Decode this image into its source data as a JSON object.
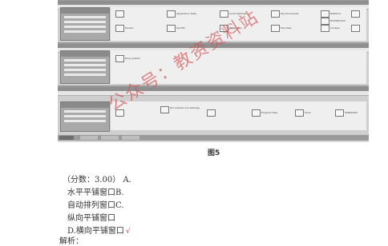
{
  "figure": {
    "caption": "图5",
    "windows": [
      {
        "folders": [
          "",
          "Application Data",
          "Local Settings",
          "My Documents",
          "NetHood",
          "NTUSER.DAT",
          "Recent",
          "SendTo",
          "Templates",
          "Favorites",
          "Cookies",
          "",
          "",
          ""
        ]
      },
      {
        "folders": [
          "Dise_system"
        ]
      },
      {
        "folders": [
          "Documents and Settings",
          "",
          "Program Files",
          "Tools",
          "WINDOWS"
        ]
      }
    ]
  },
  "question": {
    "score_line": "（分数：3.00） A.",
    "options": [
      {
        "text": "水平平铺窗口B."
      },
      {
        "text": "自动排列窗口C."
      },
      {
        "text": "纵向平铺窗口"
      },
      {
        "text": "D.横向平铺窗口"
      }
    ],
    "answer_mark": "√",
    "analysis_label": "解析："
  },
  "watermark": {
    "text": "公众号：教资资料站"
  }
}
